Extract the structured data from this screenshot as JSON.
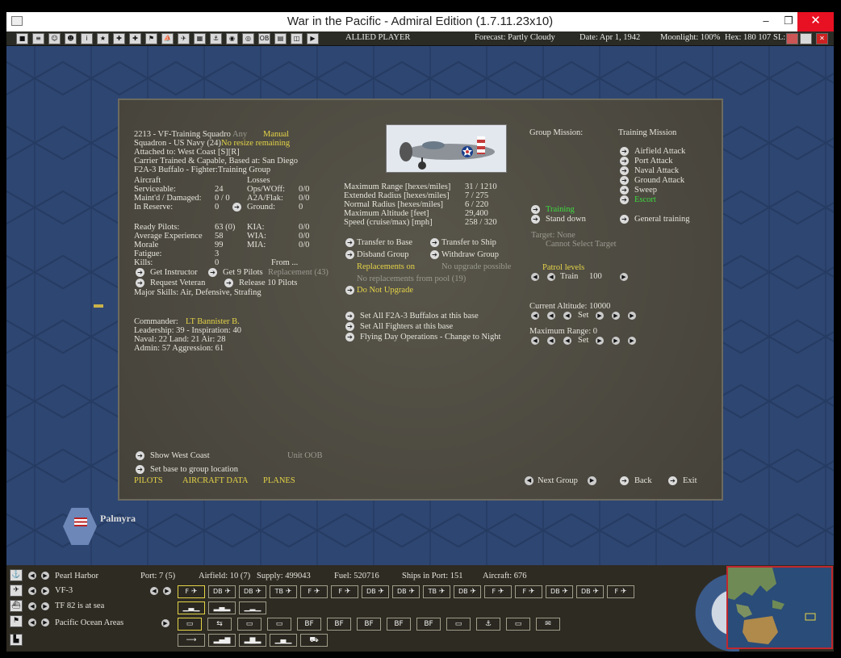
{
  "window": {
    "title": "War in the Pacific - Admiral Edition (1.7.11.23x10)",
    "min": "–",
    "max": "❐",
    "close": "✕"
  },
  "toolbar": {
    "side": "ALLIED PLAYER",
    "forecast": "Forecast: Partly Cloudy",
    "date": "Date: Apr 1, 1942",
    "moonlight": "Moonlight: 100%",
    "hex": "Hex: 180 107",
    "sl": "SL:",
    "icons": [
      "■",
      "≡",
      "☺",
      "☻",
      "i",
      "★",
      "✚",
      "✚",
      "⚑",
      "⛵",
      "✈",
      "▦",
      "⚓",
      "◉",
      "◎",
      "OB",
      "▤",
      "◫",
      "▶"
    ]
  },
  "map": {
    "base_label": "Palmyra"
  },
  "panel": {
    "header": {
      "line1": "2213 - VF-Training Squadro",
      "any": "Any",
      "manual": "Manual",
      "line2": "Squadron - US Navy (24)",
      "noresize": "No resize remaining",
      "line3": "Attached to: West Coast [S][R]",
      "line4": "Carrier Trained & Capable, Based at: San Diego",
      "line5": "F2A-3 Buffalo - Fighter:Training Group"
    },
    "aircraft": {
      "h_left": "Aircraft",
      "h_right": "Losses",
      "serv_l": "Serviceable:",
      "serv_v": "24",
      "ops_l": "Ops/WOff:",
      "ops_v": "0/0",
      "maint_l": "Maint'd / Damaged:",
      "maint_v": "0 / 0",
      "a2a_l": "A2A/Flak:",
      "a2a_v": "0/0",
      "res_l": "In Reserve:",
      "res_v": "0",
      "gnd_l": "Ground:",
      "gnd_v": "0"
    },
    "pilots": {
      "ready_l": "Ready Pilots:",
      "ready_v": "63 (0)",
      "kia_l": "KIA:",
      "kia_v": "0/0",
      "exp_l": "Average Experience",
      "exp_v": "58",
      "wia_l": "WIA:",
      "wia_v": "0/0",
      "mor_l": "Morale",
      "mor_v": "99",
      "mia_l": "MIA:",
      "mia_v": "0/0",
      "fat_l": "Fatigue:",
      "fat_v": "3",
      "kill_l": "Kills:",
      "kill_v": "0",
      "from": "From ..."
    },
    "actions": {
      "get_instructor": "Get Instructor",
      "get_pilots": "Get 9 Pilots",
      "replacement": "Replacement (43)",
      "req_vet": "Request Veteran",
      "release": "Release 10 Pilots",
      "skills": "Major Skills:  Air, Defensive, Strafing"
    },
    "commander": {
      "label": "Commander:",
      "name": "LT Bannister B.",
      "line2": "Leadership: 39 - Inspiration: 40",
      "line3": "Naval: 22  Land: 21  Air: 28",
      "line4": "Admin: 57  Aggression: 61"
    },
    "specs": {
      "l1": "Maximum Range [hexes/miles]",
      "v1": "31 / 1210",
      "l2": "Extended Radius [hexes/miles]",
      "v2": "7 / 275",
      "l3": "Normal Radius [hexes/miles]",
      "v3": "6 / 220",
      "l4": "Maximum Altitude [feet]",
      "v4": "29,400",
      "l5": "Speed (cruise/max) [mph]",
      "v5": "258 / 320"
    },
    "mid": {
      "transfer_base": "Transfer to Base",
      "transfer_ship": "Transfer to Ship",
      "disband": "Disband Group",
      "withdraw": "Withdraw Group",
      "repl_on": "Replacements on",
      "no_upgrade": "No upgrade possible",
      "no_repl": "No replacements from pool (19)",
      "do_not_upgrade": "Do Not Upgrade",
      "set_all_f2a": "Set All F2A-3 Buffalos at this base",
      "set_all_ftr": "Set All Fighters at this base",
      "flying": "Flying Day Operations - Change to Night"
    },
    "mission": {
      "label": "Group Mission:",
      "value": "Training Mission",
      "options": [
        "Airfield Attack",
        "Port Attack",
        "Naval Attack",
        "Ground Attack",
        "Sweep",
        "Escort"
      ],
      "training": "Training",
      "stand_down": "Stand down",
      "general": "General training",
      "target": "Target: None",
      "cannot": "Cannot Select Target",
      "patrol": "Patrol levels",
      "train": "Train",
      "train_v": "100",
      "altitude": "Current Altitude: 10000",
      "set": "Set",
      "maxrange": "Maximum Range: 0"
    },
    "footer": {
      "show": "Show West Coast",
      "oob": "Unit OOB",
      "setbase": "Set base to group location",
      "tab1": "PILOTS",
      "tab2": "AIRCRAFT DATA",
      "tab3": "PLANES",
      "next": "Next Group",
      "back": "Back",
      "exit": "Exit"
    }
  },
  "bottom": {
    "base": "Pearl Harbor",
    "port": "Port: 7 (5)",
    "airfield": "Airfield: 10 (7)",
    "supply": "Supply: 499043",
    "fuel": "Fuel: 520716",
    "ships": "Ships in Port: 151",
    "aircraft": "Aircraft: 676",
    "unit": "VF-3",
    "tf": "TF 82 is at sea",
    "area": "Pacific Ocean Areas",
    "air_icons": [
      "F",
      "DB",
      "DB",
      "TB",
      "F",
      "F",
      "DB",
      "DB",
      "TB",
      "DB",
      "F",
      "F",
      "DB",
      "DB",
      "F"
    ],
    "row3": [
      "▭",
      "⇆",
      "▭",
      "▭",
      "BF",
      "BF",
      "BF",
      "BF",
      "BF",
      "▭",
      "⚓",
      "▭",
      "✉"
    ]
  }
}
